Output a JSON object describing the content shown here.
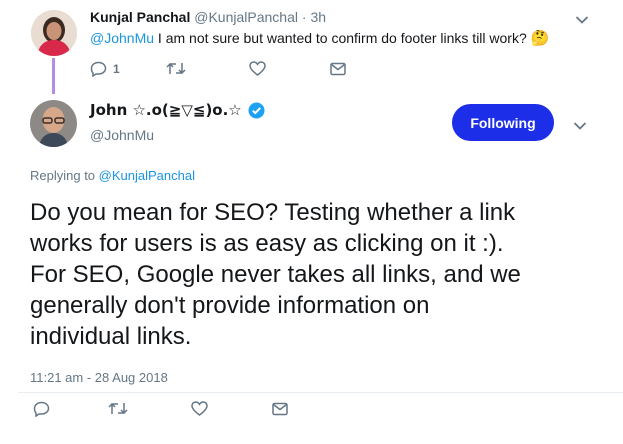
{
  "reply_tweet": {
    "author_name": "Kunjal Panchal",
    "author_handle": "@KunjalPanchal",
    "separator": "·",
    "time": "3h",
    "mention": "@JohnMu",
    "text": "I am not sure but wanted to confirm do footer links till work?",
    "emoji": "🤔",
    "reply_count": "1"
  },
  "main_tweet": {
    "author_name": "John ☆.o(≧▽≦)o.☆",
    "author_handle": "@JohnMu",
    "follow_label": "Following",
    "replying_prefix": "Replying to",
    "replying_to": "@KunjalPanchal",
    "text_lines": [
      "Do you mean for SEO? Testing whether a link",
      "works for users is as easy as clicking on it :).",
      "For SEO, Google never takes all links, and we",
      "generally don't provide information on",
      "individual links."
    ],
    "timestamp": "11:21 am - 28 Aug 2018"
  },
  "colors": {
    "accent": "#1da1f2",
    "follow_button_bg": "#1d2ee8",
    "thread_line": "#b28de0",
    "verified": "#1da1f2"
  },
  "icons": {
    "reply": "reply-icon",
    "retweet": "retweet-icon",
    "like": "heart-icon",
    "dm": "envelope-icon",
    "caret": "chevron-down-icon",
    "verified": "verified-badge-icon"
  }
}
